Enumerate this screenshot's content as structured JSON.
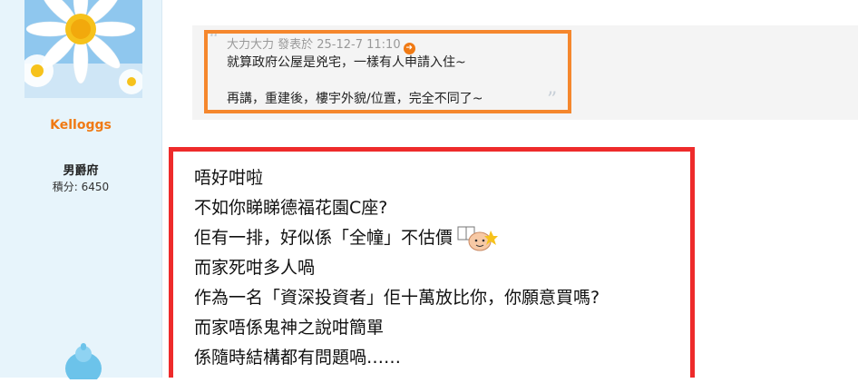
{
  "sidebar": {
    "avatar_icon": "daisy-flower-avatar",
    "username": "Kelloggs",
    "rank": "男爵府",
    "points": "積分: 6450",
    "bottom_icon": "blue-mascot-icon"
  },
  "quote": {
    "meta": "大力大力 發表於 25-12-7 11:10",
    "meta_icon": "jump-to-post-icon",
    "lines": [
      "就算政府公屋是兇宅，一樣有人申請入住~",
      "再講，重建後，樓宇外貌/位置，完全不同了~"
    ],
    "open_quote": "“",
    "close_quote": "”"
  },
  "post": {
    "lines": [
      "唔好咁啦",
      "不如你睇睇德福花園C座?",
      "佢有一排，好似係「全幢」不估價",
      "而家死咁多人喎",
      "作為一名「資深投資者」佢十萬放比你，你願意買嗎?",
      "而家唔係鬼神之說咁簡單",
      "係隨時結構都有問題喎……"
    ],
    "emoji_icon": "reading-face-emoji",
    "highlight_color": "#ee2b2b"
  },
  "colors": {
    "quote_highlight": "#f5872d",
    "username": "#f07a14",
    "sidebar_bg": "#e7f4fb"
  }
}
